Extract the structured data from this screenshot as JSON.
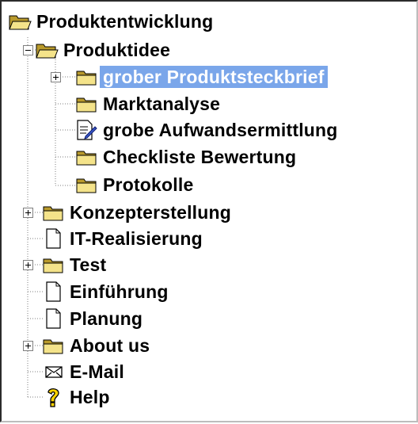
{
  "tree": {
    "items": [
      {
        "label": "Produktentwicklung",
        "icon": "folder-open-icon"
      },
      {
        "label": "Produktidee",
        "icon": "folder-open-icon",
        "expander": "minus"
      },
      {
        "label": "grober Produktsteckbrief",
        "icon": "folder-closed-icon",
        "expander": "plus",
        "selected": true
      },
      {
        "label": "Marktanalyse",
        "icon": "folder-closed-icon"
      },
      {
        "label": "grobe Aufwandsermittlung",
        "icon": "edit-document-icon"
      },
      {
        "label": "Checkliste Bewertung",
        "icon": "folder-closed-icon"
      },
      {
        "label": "Protokolle",
        "icon": "folder-closed-icon"
      },
      {
        "label": "Konzepterstellung",
        "icon": "folder-closed-icon",
        "expander": "plus"
      },
      {
        "label": "IT-Realisierung",
        "icon": "document-icon"
      },
      {
        "label": "Test",
        "icon": "folder-closed-icon",
        "expander": "plus"
      },
      {
        "label": "Einführung",
        "icon": "document-icon"
      },
      {
        "label": "Planung",
        "icon": "document-icon"
      },
      {
        "label": "About us",
        "icon": "folder-closed-icon",
        "expander": "plus"
      },
      {
        "label": "E-Mail",
        "icon": "envelope-icon"
      },
      {
        "label": "Help",
        "icon": "help-icon"
      }
    ]
  },
  "colors": {
    "selection": "#7aa6ea",
    "folder": "#f4e38a",
    "folder_dark": "#b99a2c",
    "help": "#ffd400"
  }
}
